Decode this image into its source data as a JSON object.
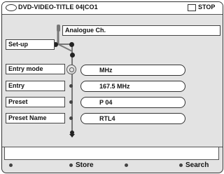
{
  "header": {
    "title": "DVD-VIDEO-TITLE 04|CO1",
    "status": "STOP",
    "icons": [
      "disc-icon",
      "stop-icon"
    ]
  },
  "menu": {
    "breadcrumb": "Analogue Ch.",
    "parent": "Set-up",
    "rows": [
      {
        "label": "Entry mode",
        "value": "MHz"
      },
      {
        "label": "Entry",
        "value": "167.5 MHz"
      },
      {
        "label": "Preset",
        "value": "P 04"
      },
      {
        "label": "Preset Name",
        "value": "RTL4"
      }
    ]
  },
  "footer": {
    "message": "",
    "buttons": [
      "",
      "Store",
      "",
      "Search"
    ]
  }
}
